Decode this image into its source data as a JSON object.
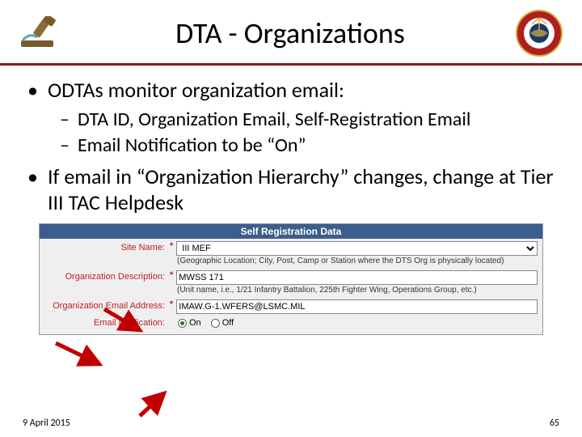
{
  "header": {
    "title": "DTA - Organizations"
  },
  "bullets": {
    "b1": "ODTAs monitor organization email:",
    "b1a": "DTA ID, Organization Email, Self-Registration Email",
    "b1b": "Email Notification to be “On”",
    "b2": "If email in “Organization Hierarchy” changes, change at Tier III TAC Helpdesk"
  },
  "form": {
    "title": "Self Registration Data",
    "site_label": "Site Name:",
    "site_value": "III MEF",
    "site_hint": "(Geographic Location; City, Post, Camp or Station where the DTS Org is physically located)",
    "org_label": "Organization Description:",
    "org_value": "MWSS 171",
    "org_hint": "(Unit name, i.e., 1/21 Infantry Battalion, 225th Fighter Wing, Operations Group, etc.)",
    "email_label": "Organization Email Address:",
    "email_value": "IMAW.G-1.WFERS@LSMC.MIL",
    "notif_label": "Email Notification:",
    "on": "On",
    "off": "Off"
  },
  "footer": {
    "date": "9 April 2015",
    "page": "65"
  }
}
